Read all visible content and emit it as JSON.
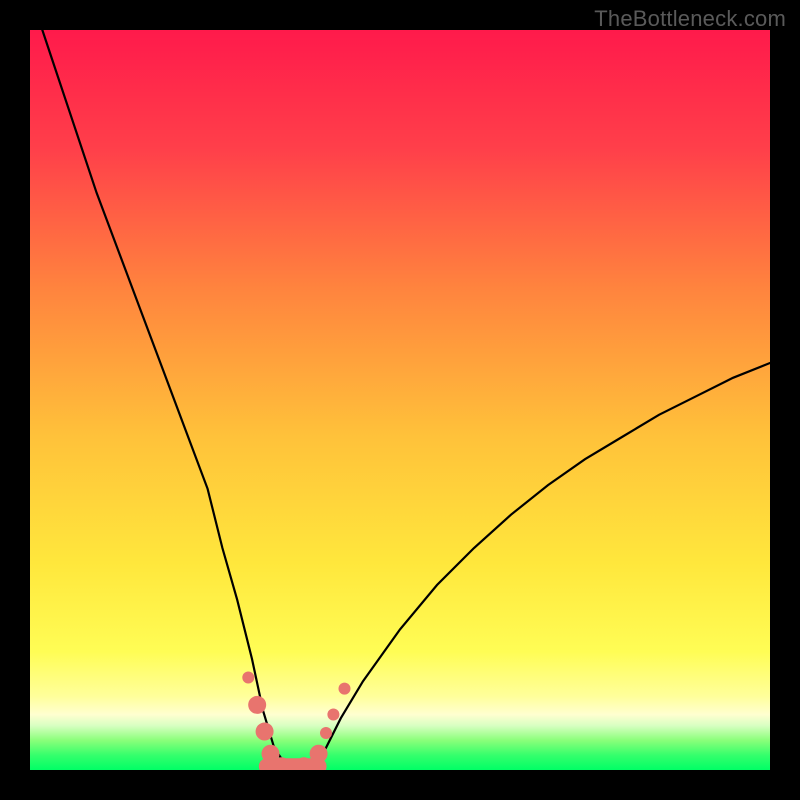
{
  "watermark": "TheBottleneck.com",
  "chart_data": {
    "type": "line",
    "title": "",
    "xlabel": "",
    "ylabel": "",
    "xlim": [
      0,
      100
    ],
    "ylim": [
      0,
      100
    ],
    "gradient_bands": [
      {
        "name": "red-top",
        "color": "#ff1a4b",
        "y": 100
      },
      {
        "name": "orange",
        "color": "#ff843e",
        "y": 65
      },
      {
        "name": "yellow",
        "color": "#ffe73c",
        "y": 35
      },
      {
        "name": "pale-yellow",
        "color": "#ffff9a",
        "y": 12
      },
      {
        "name": "light-green",
        "color": "#8aff7a",
        "y": 3
      },
      {
        "name": "green-bottom",
        "color": "#00ff66",
        "y": 0
      }
    ],
    "series": [
      {
        "name": "bottleneck-curve",
        "x": [
          0,
          3,
          6,
          9,
          12,
          15,
          18,
          21,
          24,
          26,
          28,
          30,
          31.5,
          33,
          35,
          36.5,
          38,
          40,
          42,
          45,
          50,
          55,
          60,
          65,
          70,
          75,
          80,
          85,
          90,
          95,
          100
        ],
        "values": [
          105,
          96,
          87,
          78,
          70,
          62,
          54,
          46,
          38,
          30,
          23,
          15,
          8,
          3,
          0,
          0,
          0,
          3,
          7,
          12,
          19,
          25,
          30,
          34.5,
          38.5,
          42,
          45,
          48,
          50.5,
          53,
          55
        ]
      }
    ],
    "highlight_markers": {
      "name": "bottom-cluster",
      "color": "#e8746e",
      "radius_small": 6,
      "radius_large": 9,
      "segment": {
        "x0": 32,
        "x1": 39,
        "y": 0.5
      },
      "points": [
        {
          "x": 29.5,
          "y": 12.5,
          "r": "small"
        },
        {
          "x": 30.7,
          "y": 8.8,
          "r": "large"
        },
        {
          "x": 31.7,
          "y": 5.2,
          "r": "large"
        },
        {
          "x": 32.5,
          "y": 2.2,
          "r": "large"
        },
        {
          "x": 34.0,
          "y": 0.5,
          "r": "large"
        },
        {
          "x": 37.0,
          "y": 0.5,
          "r": "large"
        },
        {
          "x": 39.0,
          "y": 2.2,
          "r": "large"
        },
        {
          "x": 40.0,
          "y": 5.0,
          "r": "small"
        },
        {
          "x": 41.0,
          "y": 7.5,
          "r": "small"
        },
        {
          "x": 42.5,
          "y": 11.0,
          "r": "small"
        }
      ]
    }
  }
}
